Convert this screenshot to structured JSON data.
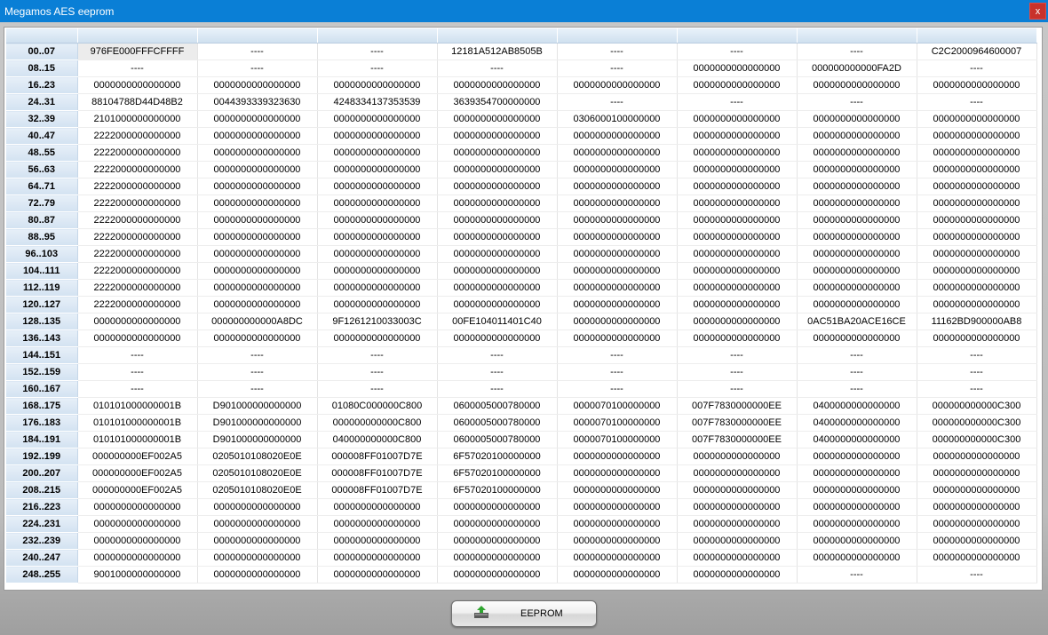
{
  "window": {
    "title": "Megamos AES eeprom",
    "close_label": "x"
  },
  "grid": {
    "rows": [
      {
        "label": "00..07",
        "cells": [
          "976FE000FFFCFFFF",
          "----",
          "----",
          "12181A512AB8505B",
          "----",
          "----",
          "----",
          "C2C2000964600007"
        ]
      },
      {
        "label": "08..15",
        "cells": [
          "----",
          "----",
          "----",
          "----",
          "----",
          "0000000000000000",
          "000000000000FA2D",
          "----"
        ]
      },
      {
        "label": "16..23",
        "cells": [
          "0000000000000000",
          "0000000000000000",
          "0000000000000000",
          "0000000000000000",
          "0000000000000000",
          "0000000000000000",
          "0000000000000000",
          "0000000000000000"
        ]
      },
      {
        "label": "24..31",
        "cells": [
          "88104788D44D48B2",
          "0044393339323630",
          "4248334137353539",
          "3639354700000000",
          "----",
          "----",
          "----",
          "----"
        ]
      },
      {
        "label": "32..39",
        "cells": [
          "2101000000000000",
          "0000000000000000",
          "0000000000000000",
          "0000000000000000",
          "0306000100000000",
          "0000000000000000",
          "0000000000000000",
          "0000000000000000"
        ]
      },
      {
        "label": "40..47",
        "cells": [
          "2222000000000000",
          "0000000000000000",
          "0000000000000000",
          "0000000000000000",
          "0000000000000000",
          "0000000000000000",
          "0000000000000000",
          "0000000000000000"
        ]
      },
      {
        "label": "48..55",
        "cells": [
          "2222000000000000",
          "0000000000000000",
          "0000000000000000",
          "0000000000000000",
          "0000000000000000",
          "0000000000000000",
          "0000000000000000",
          "0000000000000000"
        ]
      },
      {
        "label": "56..63",
        "cells": [
          "2222000000000000",
          "0000000000000000",
          "0000000000000000",
          "0000000000000000",
          "0000000000000000",
          "0000000000000000",
          "0000000000000000",
          "0000000000000000"
        ]
      },
      {
        "label": "64..71",
        "cells": [
          "2222000000000000",
          "0000000000000000",
          "0000000000000000",
          "0000000000000000",
          "0000000000000000",
          "0000000000000000",
          "0000000000000000",
          "0000000000000000"
        ]
      },
      {
        "label": "72..79",
        "cells": [
          "2222000000000000",
          "0000000000000000",
          "0000000000000000",
          "0000000000000000",
          "0000000000000000",
          "0000000000000000",
          "0000000000000000",
          "0000000000000000"
        ]
      },
      {
        "label": "80..87",
        "cells": [
          "2222000000000000",
          "0000000000000000",
          "0000000000000000",
          "0000000000000000",
          "0000000000000000",
          "0000000000000000",
          "0000000000000000",
          "0000000000000000"
        ]
      },
      {
        "label": "88..95",
        "cells": [
          "2222000000000000",
          "0000000000000000",
          "0000000000000000",
          "0000000000000000",
          "0000000000000000",
          "0000000000000000",
          "0000000000000000",
          "0000000000000000"
        ]
      },
      {
        "label": "96..103",
        "cells": [
          "2222000000000000",
          "0000000000000000",
          "0000000000000000",
          "0000000000000000",
          "0000000000000000",
          "0000000000000000",
          "0000000000000000",
          "0000000000000000"
        ]
      },
      {
        "label": "104..111",
        "cells": [
          "2222000000000000",
          "0000000000000000",
          "0000000000000000",
          "0000000000000000",
          "0000000000000000",
          "0000000000000000",
          "0000000000000000",
          "0000000000000000"
        ]
      },
      {
        "label": "112..119",
        "cells": [
          "2222000000000000",
          "0000000000000000",
          "0000000000000000",
          "0000000000000000",
          "0000000000000000",
          "0000000000000000",
          "0000000000000000",
          "0000000000000000"
        ]
      },
      {
        "label": "120..127",
        "cells": [
          "2222000000000000",
          "0000000000000000",
          "0000000000000000",
          "0000000000000000",
          "0000000000000000",
          "0000000000000000",
          "0000000000000000",
          "0000000000000000"
        ]
      },
      {
        "label": "128..135",
        "cells": [
          "0000000000000000",
          "000000000000A8DC",
          "9F1261210033003C",
          "00FE104011401C40",
          "0000000000000000",
          "0000000000000000",
          "0AC51BA20ACE16CE",
          "11162BD900000AB8"
        ]
      },
      {
        "label": "136..143",
        "cells": [
          "0000000000000000",
          "0000000000000000",
          "0000000000000000",
          "0000000000000000",
          "0000000000000000",
          "0000000000000000",
          "0000000000000000",
          "0000000000000000"
        ]
      },
      {
        "label": "144..151",
        "cells": [
          "----",
          "----",
          "----",
          "----",
          "----",
          "----",
          "----",
          "----"
        ]
      },
      {
        "label": "152..159",
        "cells": [
          "----",
          "----",
          "----",
          "----",
          "----",
          "----",
          "----",
          "----"
        ]
      },
      {
        "label": "160..167",
        "cells": [
          "----",
          "----",
          "----",
          "----",
          "----",
          "----",
          "----",
          "----"
        ]
      },
      {
        "label": "168..175",
        "cells": [
          "010101000000001B",
          "D901000000000000",
          "01080C000000C800",
          "0600005000780000",
          "0000070100000000",
          "007F7830000000EE",
          "0400000000000000",
          "000000000000C300"
        ]
      },
      {
        "label": "176..183",
        "cells": [
          "010101000000001B",
          "D901000000000000",
          "000000000000C800",
          "0600005000780000",
          "0000070100000000",
          "007F7830000000EE",
          "0400000000000000",
          "000000000000C300"
        ]
      },
      {
        "label": "184..191",
        "cells": [
          "010101000000001B",
          "D901000000000000",
          "040000000000C800",
          "0600005000780000",
          "0000070100000000",
          "007F7830000000EE",
          "0400000000000000",
          "000000000000C300"
        ]
      },
      {
        "label": "192..199",
        "cells": [
          "000000000EF002A5",
          "0205010108020E0E",
          "000008FF01007D7E",
          "6F57020100000000",
          "0000000000000000",
          "0000000000000000",
          "0000000000000000",
          "0000000000000000"
        ]
      },
      {
        "label": "200..207",
        "cells": [
          "000000000EF002A5",
          "0205010108020E0E",
          "000008FF01007D7E",
          "6F57020100000000",
          "0000000000000000",
          "0000000000000000",
          "0000000000000000",
          "0000000000000000"
        ]
      },
      {
        "label": "208..215",
        "cells": [
          "000000000EF002A5",
          "0205010108020E0E",
          "000008FF01007D7E",
          "6F57020100000000",
          "0000000000000000",
          "0000000000000000",
          "0000000000000000",
          "0000000000000000"
        ]
      },
      {
        "label": "216..223",
        "cells": [
          "0000000000000000",
          "0000000000000000",
          "0000000000000000",
          "0000000000000000",
          "0000000000000000",
          "0000000000000000",
          "0000000000000000",
          "0000000000000000"
        ]
      },
      {
        "label": "224..231",
        "cells": [
          "0000000000000000",
          "0000000000000000",
          "0000000000000000",
          "0000000000000000",
          "0000000000000000",
          "0000000000000000",
          "0000000000000000",
          "0000000000000000"
        ]
      },
      {
        "label": "232..239",
        "cells": [
          "0000000000000000",
          "0000000000000000",
          "0000000000000000",
          "0000000000000000",
          "0000000000000000",
          "0000000000000000",
          "0000000000000000",
          "0000000000000000"
        ]
      },
      {
        "label": "240..247",
        "cells": [
          "0000000000000000",
          "0000000000000000",
          "0000000000000000",
          "0000000000000000",
          "0000000000000000",
          "0000000000000000",
          "0000000000000000",
          "0000000000000000"
        ]
      },
      {
        "label": "248..255",
        "cells": [
          "9001000000000000",
          "0000000000000000",
          "0000000000000000",
          "0000000000000000",
          "0000000000000000",
          "0000000000000000",
          "----",
          "----"
        ]
      }
    ]
  },
  "footer": {
    "eeprom_button_label": "EEPROM",
    "eeprom_button_icon": "upload-icon"
  },
  "colors": {
    "titlebar": "#0a7fd6",
    "close": "#c8322b",
    "header": "#d3e2f1"
  }
}
